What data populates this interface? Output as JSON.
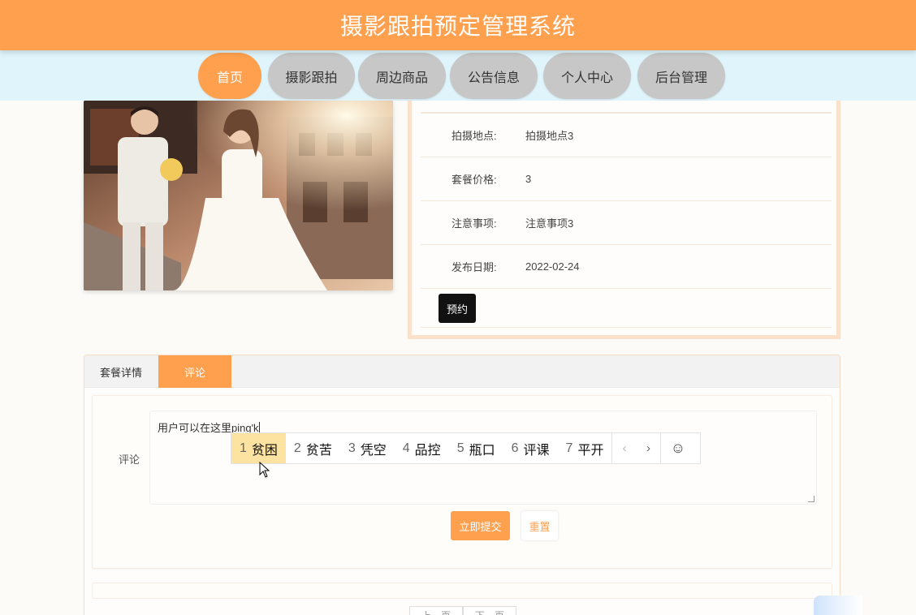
{
  "header": {
    "title": "摄影跟拍预定管理系统"
  },
  "nav": [
    {
      "label": "首页",
      "active": true
    },
    {
      "label": "摄影跟拍",
      "active": false
    },
    {
      "label": "周边商品",
      "active": false
    },
    {
      "label": "公告信息",
      "active": false
    },
    {
      "label": "个人中心",
      "active": false
    },
    {
      "label": "后台管理",
      "active": false
    }
  ],
  "details": {
    "rows": [
      {
        "label": "拍摄地点:",
        "value": "拍摄地点3"
      },
      {
        "label": "套餐价格:",
        "value": "3"
      },
      {
        "label": "注意事项:",
        "value": "注意事项3"
      },
      {
        "label": "发布日期:",
        "value": "2022-02-24"
      }
    ],
    "book_label": "预约"
  },
  "tabs": [
    {
      "label": "套餐详情",
      "active": false
    },
    {
      "label": "评论",
      "active": true
    }
  ],
  "comment_form": {
    "label": "评论",
    "value": "用户可以在这里ping'k",
    "submit_label": "立即提交",
    "reset_label": "重置"
  },
  "ime": {
    "candidates": [
      {
        "num": "1",
        "text": "贫困",
        "selected": true
      },
      {
        "num": "2",
        "text": "贫苦",
        "selected": false
      },
      {
        "num": "3",
        "text": "凭空",
        "selected": false
      },
      {
        "num": "4",
        "text": "品控",
        "selected": false
      },
      {
        "num": "5",
        "text": "瓶口",
        "selected": false
      },
      {
        "num": "6",
        "text": "评课",
        "selected": false
      },
      {
        "num": "7",
        "text": "平开",
        "selected": false
      }
    ],
    "prev_icon": "chevron-left-icon",
    "next_icon": "chevron-right-icon",
    "emoji_icon": "smiley-icon"
  },
  "pager": {
    "prev_label": "上一页",
    "next_label": "下一页"
  },
  "colors": {
    "accent": "#ffa04f",
    "nav_bg": "#dff4fb",
    "nav_inactive": "#c7c7c7",
    "ime_selected": "#fde3a2"
  }
}
